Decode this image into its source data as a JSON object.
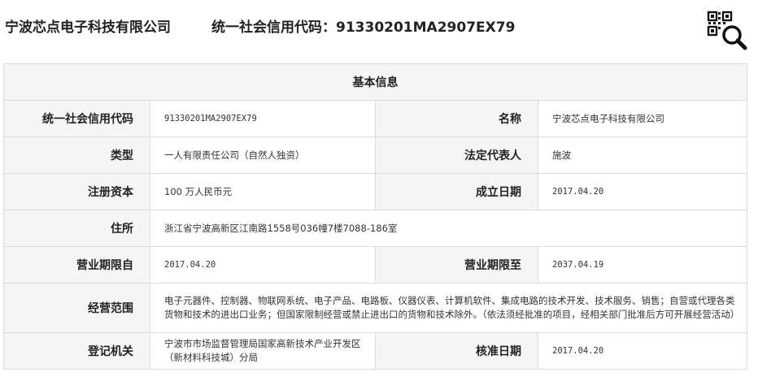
{
  "header": {
    "company_name": "宁波芯点电子科技有限公司",
    "credit_code_line": "统一社会信用代码：91330201MA2907EX79",
    "qr_search_icon": "qr-code-search-icon"
  },
  "table": {
    "title": "基本信息",
    "rows": [
      {
        "label_a": "统一社会信用代码",
        "value_a": "91330201MA2907EX79",
        "label_b": "名称",
        "value_b": "宁波芯点电子科技有限公司"
      },
      {
        "label_a": "类型",
        "value_a": "一人有限责任公司（自然人独资）",
        "label_b": "法定代表人",
        "value_b": "施波"
      },
      {
        "label_a": "注册资本",
        "value_a": "100 万人民币元",
        "label_b": "成立日期",
        "value_b": "2017.04.20"
      },
      {
        "label_a": "住所",
        "value_a": "浙江省宁波高新区江南路1558号036幢7楼7088-186室"
      },
      {
        "label_a": "营业期限自",
        "value_a": "2017.04.20",
        "label_b": "营业期限至",
        "value_b": "2037.04.19"
      },
      {
        "label_a": "经营范围",
        "value_a": "电子元器件、控制器、物联网系统、电子产品、电路板、仪器仪表、计算机软件、集成电路的技术开发、技术服务、销售；自营或代理各类货物和技术的进出口业务；但国家限制经营或禁止进出口的货物和技术除外。（依法须经批准的项目，经相关部门批准后方可开展经营活动）"
      },
      {
        "label_a": "登记机关",
        "value_a": "宁波市市场监督管理局国家高新技术产业开发区（新材料科技城）分局",
        "label_b": "核准日期",
        "value_b": "2017.04.20"
      }
    ]
  }
}
